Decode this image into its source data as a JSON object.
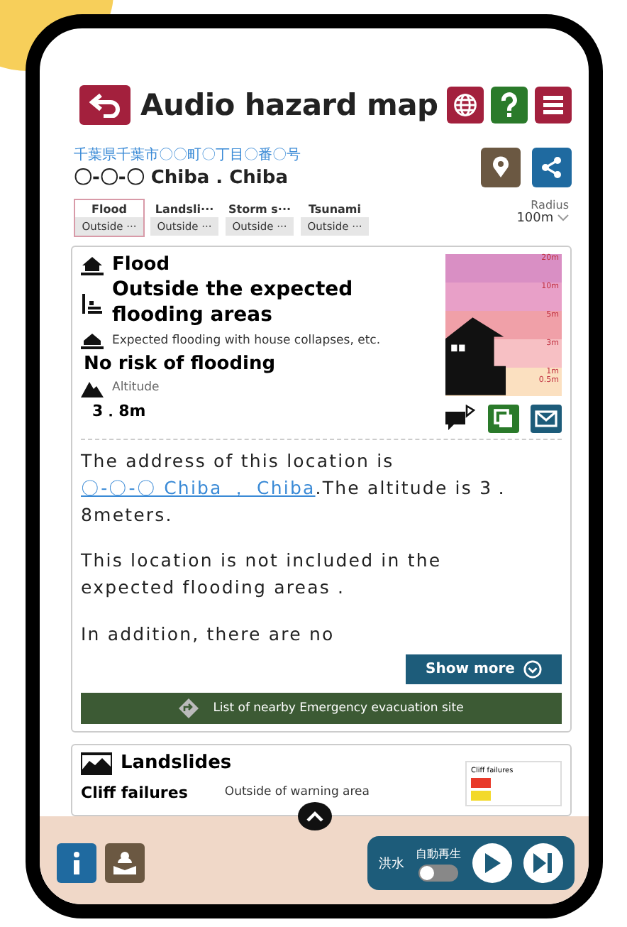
{
  "header": {
    "title": "Audio hazard map"
  },
  "address": {
    "kanji": "千葉県千葉市〇〇町〇丁目〇番〇号",
    "name": "〇-〇-〇 Chiba . Chiba"
  },
  "tabs": [
    {
      "label": "Flood",
      "status": "Outside ···",
      "selected": true
    },
    {
      "label": "Landsli···",
      "status": "Outside ···",
      "selected": false
    },
    {
      "label": "Storm s···",
      "status": "Outside ···",
      "selected": false
    },
    {
      "label": "Tsunami",
      "status": "Outside ···",
      "selected": false
    }
  ],
  "radius": {
    "label": "Radius",
    "value": "100m"
  },
  "flood": {
    "title": "Flood",
    "result": "Outside the expected flooding areas",
    "collapse_label": "Expected flooding with house collapses, etc.",
    "collapse_value": "No risk of flooding",
    "altitude_label": "Altitude",
    "altitude_value": "3．8m",
    "depth_scale": [
      {
        "label": "20m",
        "color": "#d98fc4"
      },
      {
        "label": "10m",
        "color": "#e8a0c8"
      },
      {
        "label": "5m",
        "color": "#f0a0a8"
      },
      {
        "label": "3m",
        "color": "#f7c0c4"
      },
      {
        "label": "1m\n0.5m",
        "color": "#fbe0c0"
      }
    ],
    "description": [
      {
        "kind": "with_link",
        "before": "The address of this location is ",
        "link": "〇-〇-〇 Chiba ， Chiba",
        "after": ".The altitude is 3．8meters."
      },
      {
        "kind": "plain",
        "text": "This location is not included in the expected flooding areas ."
      },
      {
        "kind": "plain",
        "text": "In addition, there are no"
      }
    ],
    "show_more": "Show more",
    "evacuation": "List of nearby Emergency evacuation site"
  },
  "landslides": {
    "title": "Landslides",
    "row_label": "Cliff failures",
    "row_value": "Outside of warning area",
    "legend_title": "Cliff failures"
  },
  "player": {
    "mode": "洪水",
    "autoplay_label": "自動再生",
    "autoplay_on": false
  }
}
